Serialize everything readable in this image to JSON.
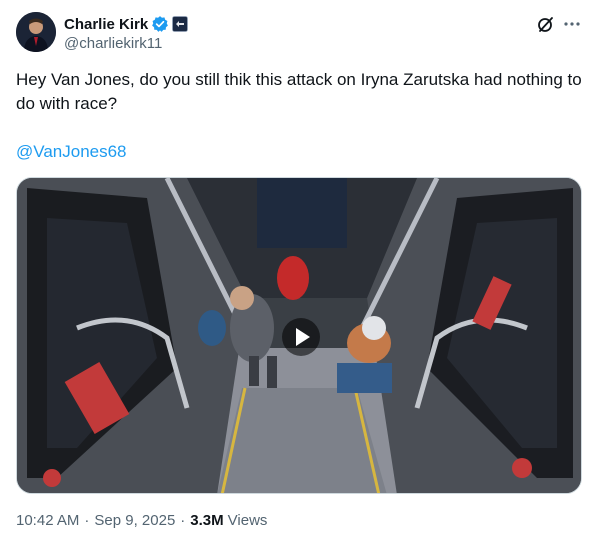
{
  "author": {
    "display_name": "Charlie Kirk",
    "handle": "@charliekirk11",
    "verified": true,
    "avatar": "person-avatar"
  },
  "tweet": {
    "text": "Hey Van Jones, do you still thik this attack on Iryna Zarutska had nothing to do with race?",
    "mention": "@VanJones68"
  },
  "media": {
    "type": "video",
    "description_icon": "play-icon"
  },
  "meta": {
    "time": "10:42 AM",
    "separator": "·",
    "date": "Sep 9, 2025",
    "views_count": "3.3M",
    "views_label": "Views"
  },
  "icons": {
    "grok": "grok-icon",
    "more": "more-icon",
    "verified": "verified-badge-icon",
    "affiliation": "affiliation-badge-icon"
  },
  "colors": {
    "link": "#1d9bf0",
    "secondary_text": "#536471",
    "primary_text": "#0f1419",
    "verified": "#1d9bf0"
  }
}
